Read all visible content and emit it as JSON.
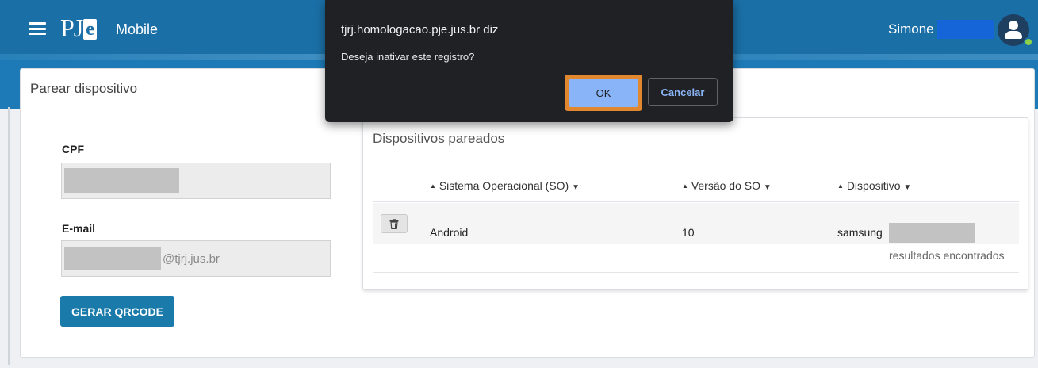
{
  "header": {
    "app_name": "Mobile",
    "logo_text_pj": "PJ",
    "logo_text_e": "e",
    "user_name": "Simone",
    "menu_icon": "hamburger-icon",
    "avatar_icon": "user-avatar-icon"
  },
  "pair_card": {
    "title": "Parear dispositivo",
    "cpf_label": "CPF",
    "email_label": "E-mail",
    "email_suffix": "@tjrj.jus.br",
    "qr_button": "GERAR QRCODE"
  },
  "devices": {
    "title": "Dispositivos pareados",
    "columns": [
      "Sistema Operacional (SO)",
      "Versão do SO",
      "Dispositivo"
    ],
    "rows": [
      {
        "os": "Android",
        "version": "10",
        "device": "samsung"
      }
    ],
    "delete_icon": "trash-icon",
    "results_text": "resultados encontrados"
  },
  "dialog": {
    "title": "tjrj.homologacao.pje.jus.br diz",
    "message": "Deseja inativar este registro?",
    "ok": "OK",
    "cancel": "Cancelar"
  },
  "colors": {
    "header": "#1a6fa6",
    "primary_button": "#1a7bab",
    "dialog_bg": "#202124",
    "dialog_accent": "#8ab4f8",
    "focus_ring": "#e08730"
  }
}
